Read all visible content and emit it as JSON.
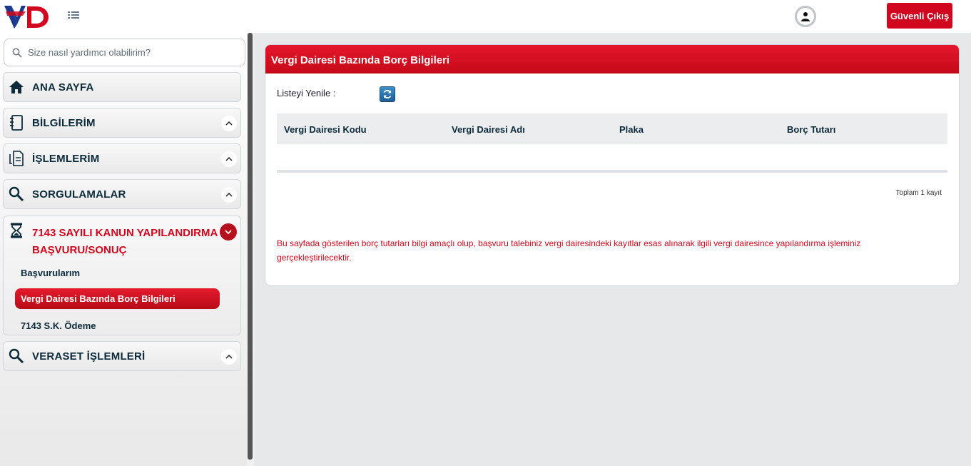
{
  "header": {
    "logo_text": "VD",
    "logout_label": "Güvenli Çıkış"
  },
  "sidebar": {
    "search_placeholder": "Size nasıl yardımcı olabilirim?",
    "items": [
      {
        "label": "ANA SAYFA",
        "icon": "home-icon"
      },
      {
        "label": "BİLGİLERİM",
        "icon": "notebook-icon"
      },
      {
        "label": "İŞLEMLERİM",
        "icon": "document-icon"
      },
      {
        "label": "SORGULAMALAR",
        "icon": "search-icon"
      },
      {
        "label": "7143 SAYILI KANUN YAPILANDIRMA BAŞVURU/SONUÇ",
        "icon": "hourglass-icon",
        "children": [
          "Başvurularım",
          "Vergi Dairesi Bazında Borç Bilgileri",
          "7143 S.K. Ödeme"
        ]
      },
      {
        "label": "VERASET İŞLEMLERİ",
        "icon": "search-icon"
      }
    ]
  },
  "panel": {
    "title": "Vergi Dairesi Bazında Borç Bilgileri",
    "refresh_label": "Listeyi Yenile :",
    "columns": [
      "Vergi Dairesi Kodu",
      "Vergi Dairesi Adı",
      "Plaka",
      "Borç Tutarı"
    ],
    "rows": [],
    "total": "Toplam 1 kayıt",
    "note": "Bu sayfada gösterilen borç tutarları bilgi amaçlı olup, başvuru talebiniz vergi dairesindeki kayıtlar esas alınarak ilgili vergi dairesince yapılandırma işleminiz gerçekleştirilecektir."
  },
  "colors": {
    "brand_red": "#d0071e",
    "brand_navy": "#0b2a3a",
    "refresh_blue": "#2a74b0"
  }
}
